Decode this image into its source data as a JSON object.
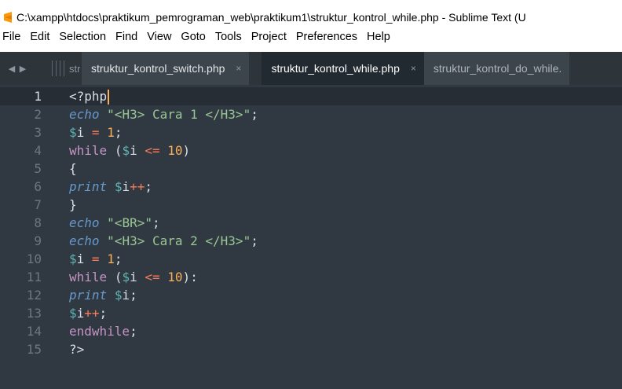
{
  "window": {
    "title": "C:\\xampp\\htdocs\\praktikum_pemrograman_web\\praktikum1\\struktur_kontrol_while.php - Sublime Text (U"
  },
  "menu": {
    "items": [
      "File",
      "Edit",
      "Selection",
      "Find",
      "View",
      "Goto",
      "Tools",
      "Project",
      "Preferences",
      "Help"
    ]
  },
  "tabs": {
    "peek_label": "str",
    "items": [
      {
        "label": "struktur_kontrol_switch.php",
        "close": "×",
        "active": false
      },
      {
        "label": "struktur_kontrol_while.php",
        "close": "×",
        "active": true
      },
      {
        "label": "struktur_kontrol_do_while.",
        "close": "",
        "active": false
      }
    ]
  },
  "nav": {
    "back": "◀",
    "forward": "▶"
  },
  "editor": {
    "language": "php",
    "current_line": 1,
    "lines": [
      {
        "n": "1",
        "text": "<?php"
      },
      {
        "n": "2",
        "text": "echo \"<H3> Cara 1 </H3>\";"
      },
      {
        "n": "3",
        "text": "$i = 1;"
      },
      {
        "n": "4",
        "text": "while ($i <= 10)"
      },
      {
        "n": "5",
        "text": "{"
      },
      {
        "n": "6",
        "text": "print $i++;"
      },
      {
        "n": "7",
        "text": "}"
      },
      {
        "n": "8",
        "text": "echo \"<BR>\";"
      },
      {
        "n": "9",
        "text": "echo \"<H3> Cara 2 </H3>\";"
      },
      {
        "n": "10",
        "text": "$i = 1;"
      },
      {
        "n": "11",
        "text": "while ($i <= 10):"
      },
      {
        "n": "12",
        "text": "print $i;"
      },
      {
        "n": "13",
        "text": "$i++;"
      },
      {
        "n": "14",
        "text": "endwhile;"
      },
      {
        "n": "15",
        "text": "?>"
      }
    ]
  },
  "colors": {
    "editor_bg": "#303841",
    "tabbar_bg": "#2d353b",
    "active_tab_bg": "#212a30",
    "caret": "#f9ae58",
    "string": "#99c794",
    "keyword": "#c594c5",
    "number": "#f9ae58",
    "echo": "#6699cc"
  }
}
